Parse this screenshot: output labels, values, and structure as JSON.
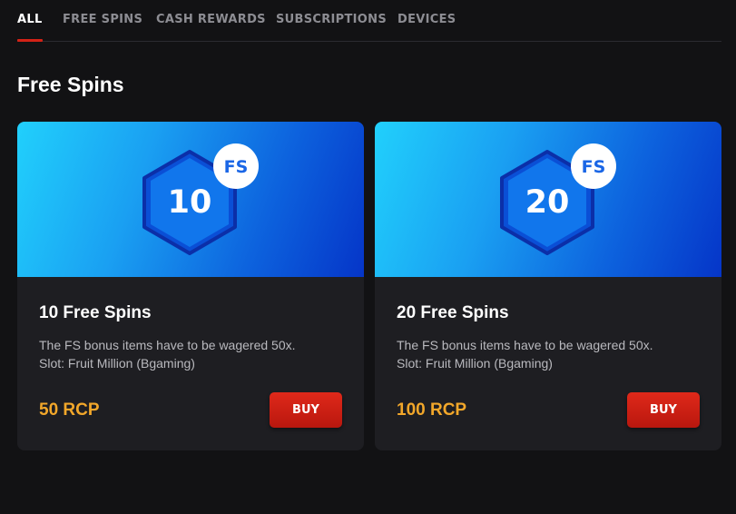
{
  "tabs": [
    {
      "label": "ALL",
      "active": true
    },
    {
      "label": "FREE SPINS",
      "active": false
    },
    {
      "label": "CASH REWARDS",
      "active": false
    },
    {
      "label": "SUBSCRIPTIONS",
      "active": false
    },
    {
      "label": "DEVICES",
      "active": false
    }
  ],
  "section": {
    "title": "Free Spins"
  },
  "cards": [
    {
      "badge_number": "10",
      "badge_label": "FS",
      "title": "10 Free Spins",
      "description_line1": "The FS bonus items have to be wagered 50x.",
      "description_line2": "Slot: Fruit Million (Bgaming)",
      "price": "50 RCP",
      "buy_label": "BUY"
    },
    {
      "badge_number": "20",
      "badge_label": "FS",
      "title": "20 Free Spins",
      "description_line1": "The FS bonus items have to be wagered 50x.",
      "description_line2": "Slot: Fruit Million (Bgaming)",
      "price": "100 RCP",
      "buy_label": "BUY"
    }
  ],
  "colors": {
    "background": "#121214",
    "card": "#1e1e22",
    "accent_red": "#d32216",
    "price_orange": "#f2a72a",
    "banner_cyan": "#21d0fc",
    "banner_blue": "#0535c8"
  }
}
